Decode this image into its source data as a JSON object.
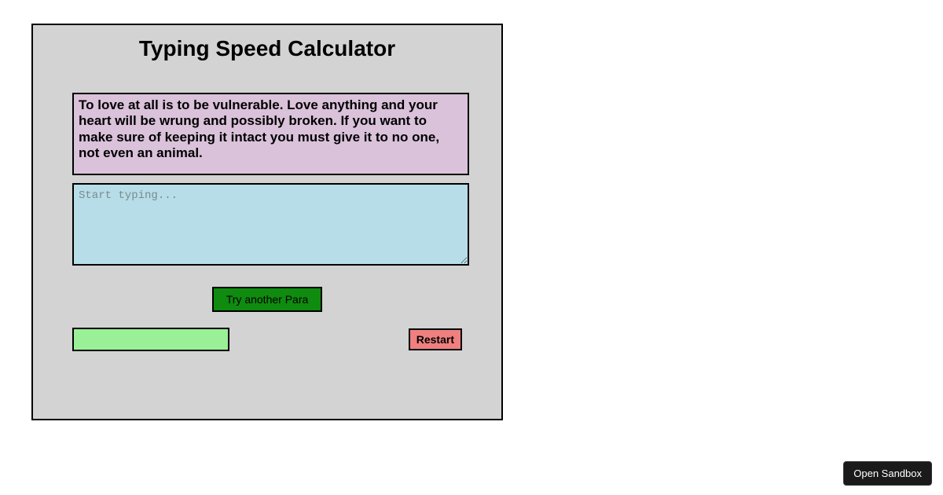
{
  "app": {
    "title": "Typing Speed Calculator"
  },
  "prompt": {
    "text": "To love at all is to be vulnerable. Love anything and your heart will be wrung and possibly broken. If you want to make sure of keeping it intact you must give it to no one, not even an animal."
  },
  "typing": {
    "value": "",
    "placeholder": "Start typing..."
  },
  "buttons": {
    "try_another": "Try another Para",
    "restart": "Restart"
  },
  "result": {
    "text": ""
  },
  "sandbox": {
    "label": "Open Sandbox"
  }
}
